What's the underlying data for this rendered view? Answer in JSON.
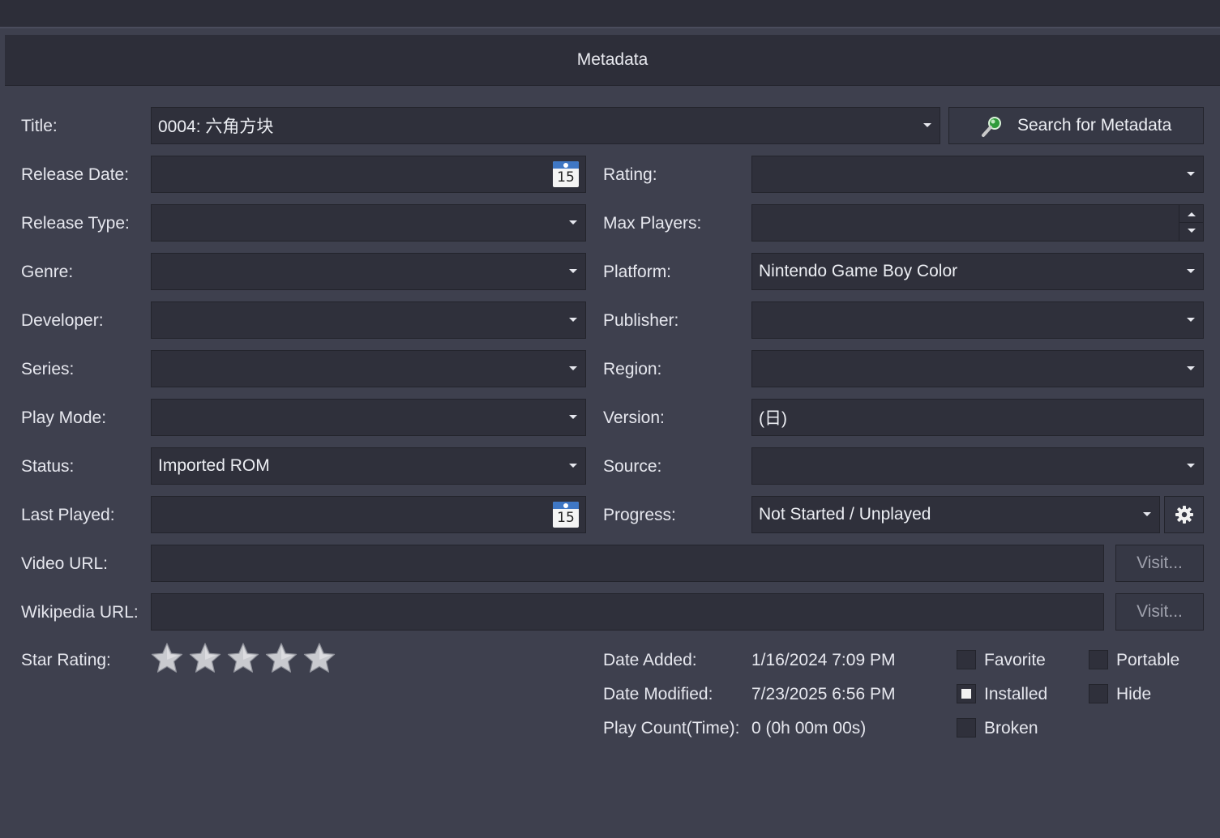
{
  "header": {
    "title": "Metadata"
  },
  "title_row": {
    "label": "Title:",
    "value": "0004: 六角方块",
    "search_button": "Search for Metadata"
  },
  "left": {
    "release_date": {
      "label": "Release Date:",
      "value": "",
      "calendar_day": "15"
    },
    "release_type": {
      "label": "Release Type:",
      "value": ""
    },
    "genre": {
      "label": "Genre:",
      "value": ""
    },
    "developer": {
      "label": "Developer:",
      "value": ""
    },
    "series": {
      "label": "Series:",
      "value": ""
    },
    "play_mode": {
      "label": "Play Mode:",
      "value": ""
    },
    "status": {
      "label": "Status:",
      "value": "Imported ROM"
    },
    "last_played": {
      "label": "Last Played:",
      "value": "",
      "calendar_day": "15"
    }
  },
  "right": {
    "rating": {
      "label": "Rating:",
      "value": ""
    },
    "max_players": {
      "label": "Max Players:",
      "value": ""
    },
    "platform": {
      "label": "Platform:",
      "value": "Nintendo Game Boy Color"
    },
    "publisher": {
      "label": "Publisher:",
      "value": ""
    },
    "region": {
      "label": "Region:",
      "value": ""
    },
    "version": {
      "label": "Version:",
      "value": "(日)"
    },
    "source": {
      "label": "Source:",
      "value": ""
    },
    "progress": {
      "label": "Progress:",
      "value": "Not Started / Unplayed"
    }
  },
  "urls": {
    "video": {
      "label": "Video URL:",
      "value": "",
      "button": "Visit..."
    },
    "wikipedia": {
      "label": "Wikipedia URL:",
      "value": "",
      "button": "Visit..."
    }
  },
  "star_rating": {
    "label": "Star Rating:",
    "value": 0,
    "max": 5
  },
  "info": {
    "date_added": {
      "label": "Date Added:",
      "value": "1/16/2024 7:09 PM"
    },
    "date_modified": {
      "label": "Date Modified:",
      "value": "7/23/2025 6:56 PM"
    },
    "play_count": {
      "label": "Play Count(Time):",
      "value": "0 (0h 00m 00s)"
    }
  },
  "flags": {
    "favorite": {
      "label": "Favorite",
      "checked": false
    },
    "installed": {
      "label": "Installed",
      "checked": true
    },
    "broken": {
      "label": "Broken",
      "checked": false
    },
    "portable": {
      "label": "Portable",
      "checked": false
    },
    "hide": {
      "label": "Hide",
      "checked": false
    }
  },
  "icons": {
    "search": "magnifier-icon",
    "calendar": "calendar-icon",
    "settings": "gear-icon",
    "star": "star-icon"
  }
}
